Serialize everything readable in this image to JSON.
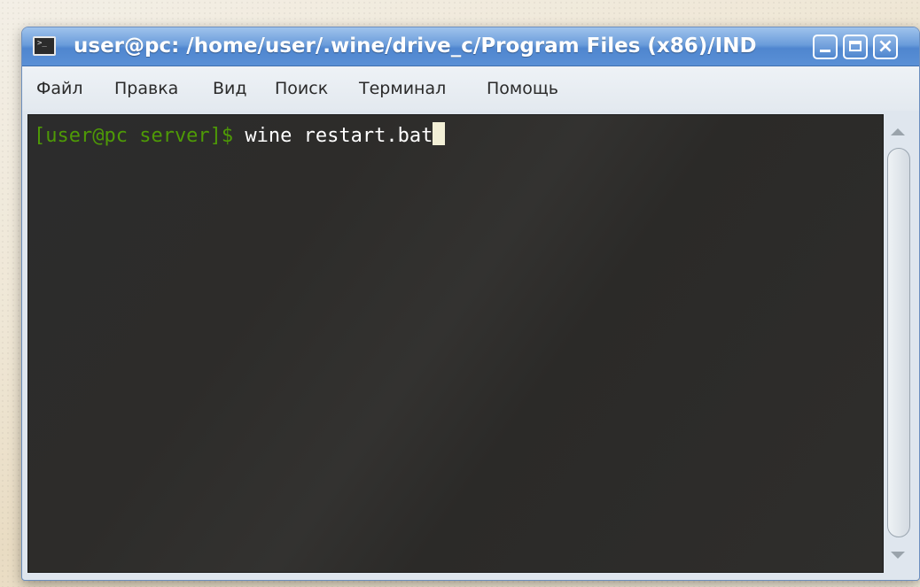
{
  "window": {
    "title": "user@pc: /home/user/.wine/drive_c/Program Files (x86)/IND",
    "controls": {
      "minimize_icon": "minimize-icon",
      "maximize_icon": "maximize-icon",
      "close_icon": "close-icon"
    }
  },
  "menubar": {
    "items": [
      {
        "label": "Файл"
      },
      {
        "label": "Правка"
      },
      {
        "label": "Вид"
      },
      {
        "label": "Поиск"
      },
      {
        "label": "Терминал"
      },
      {
        "label": "Помощь"
      }
    ]
  },
  "terminal": {
    "prompt": "[user@pc server]$",
    "command": "wine restart.bat",
    "colors": {
      "prompt": "#4e9a06",
      "command": "#ffffff",
      "cursor": "#f2efd6",
      "background": "#2c2c2c"
    }
  },
  "icons": {
    "app": "terminal-icon",
    "scroll_up": "scroll-up-arrow-icon",
    "scroll_down": "scroll-down-arrow-icon"
  },
  "colors": {
    "titlebar_accent": "#5a90d6"
  }
}
